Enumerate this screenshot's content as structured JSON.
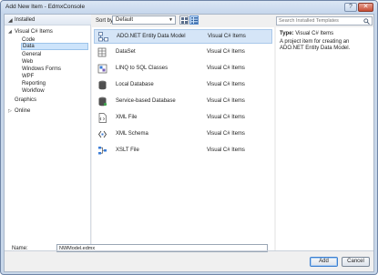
{
  "window": {
    "title": "Add New Item - EdmxConsole",
    "help_glyph": "?",
    "close_glyph": "✕"
  },
  "tree": {
    "installed": "Installed",
    "items": [
      {
        "label": "Visual C# Items",
        "expander": "◢"
      },
      {
        "label": "Code"
      },
      {
        "label": "Data",
        "selected": true
      },
      {
        "label": "General"
      },
      {
        "label": "Web"
      },
      {
        "label": "Windows Forms"
      },
      {
        "label": "WPF"
      },
      {
        "label": "Reporting"
      },
      {
        "label": "Workflow"
      },
      {
        "label": "Graphics"
      },
      {
        "label": "Online",
        "expander": "▷"
      }
    ]
  },
  "toolbar": {
    "sort_label": "Sort by:",
    "sort_value": "Default",
    "search_placeholder": "Search Installed Templates"
  },
  "templates": [
    {
      "name": "ADO.NET Entity Data Model",
      "category": "Visual C# Items",
      "icon": "entity-model-icon",
      "selected": true
    },
    {
      "name": "DataSet",
      "category": "Visual C# Items",
      "icon": "dataset-icon"
    },
    {
      "name": "LINQ to SQL Classes",
      "category": "Visual C# Items",
      "icon": "linq-icon"
    },
    {
      "name": "Local Database",
      "category": "Visual C# Items",
      "icon": "database-icon"
    },
    {
      "name": "Service-based Database",
      "category": "Visual C# Items",
      "icon": "service-database-icon"
    },
    {
      "name": "XML File",
      "category": "Visual C# Items",
      "icon": "xml-file-icon"
    },
    {
      "name": "XML Schema",
      "category": "Visual C# Items",
      "icon": "xml-schema-icon"
    },
    {
      "name": "XSLT File",
      "category": "Visual C# Items",
      "icon": "xslt-file-icon"
    }
  ],
  "description": {
    "type_label": "Type:",
    "type_value": "Visual C# Items",
    "text": "A project item for creating an ADO.NET Entity Data Model."
  },
  "footer": {
    "name_label": "Name:",
    "name_value": "NWModel.edmx",
    "add_label": "Add",
    "cancel_label": "Cancel"
  },
  "colors": {
    "selection": "#cde4fb",
    "selection_border": "#9cc3ea",
    "frame": "#c8d7ea"
  }
}
